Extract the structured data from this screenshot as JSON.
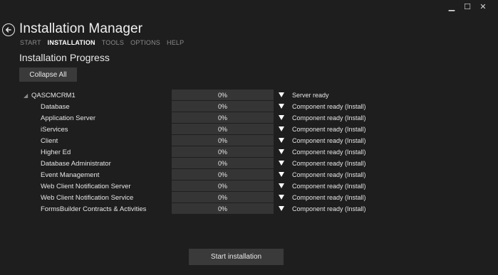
{
  "window": {
    "minimize_glyph": "▁",
    "maximize_glyph": "☐",
    "close_glyph": "✕"
  },
  "header": {
    "title": "Installation Manager",
    "nav": [
      {
        "label": "START",
        "active": false
      },
      {
        "label": "INSTALLATION",
        "active": true
      },
      {
        "label": "TOOLS",
        "active": false
      },
      {
        "label": "OPTIONS",
        "active": false
      },
      {
        "label": "HELP",
        "active": false
      }
    ]
  },
  "main": {
    "section_title": "Installation Progress",
    "collapse_label": "Collapse All",
    "server": {
      "name": "QASCMCRM1",
      "expander_glyph": "◢",
      "progress": "0%",
      "status": "Server ready"
    },
    "components": [
      {
        "name": "Database",
        "progress": "0%",
        "status": "Component ready (Install)"
      },
      {
        "name": "Application Server",
        "progress": "0%",
        "status": "Component ready (Install)"
      },
      {
        "name": "iServices",
        "progress": "0%",
        "status": "Component ready (Install)"
      },
      {
        "name": "Client",
        "progress": "0%",
        "status": "Component ready (Install)"
      },
      {
        "name": "Higher Ed",
        "progress": "0%",
        "status": "Component ready (Install)"
      },
      {
        "name": "Database Administrator",
        "progress": "0%",
        "status": "Component ready (Install)"
      },
      {
        "name": "Event Management",
        "progress": "0%",
        "status": "Component ready (Install)"
      },
      {
        "name": "Web Client Notification Server",
        "progress": "0%",
        "status": "Component ready (Install)"
      },
      {
        "name": "Web Client Notification Service",
        "progress": "0%",
        "status": "Component ready (Install)"
      },
      {
        "name": "FormsBuilder Contracts & Activities",
        "progress": "0%",
        "status": "Component ready (Install)"
      }
    ],
    "start_label": "Start installation"
  }
}
